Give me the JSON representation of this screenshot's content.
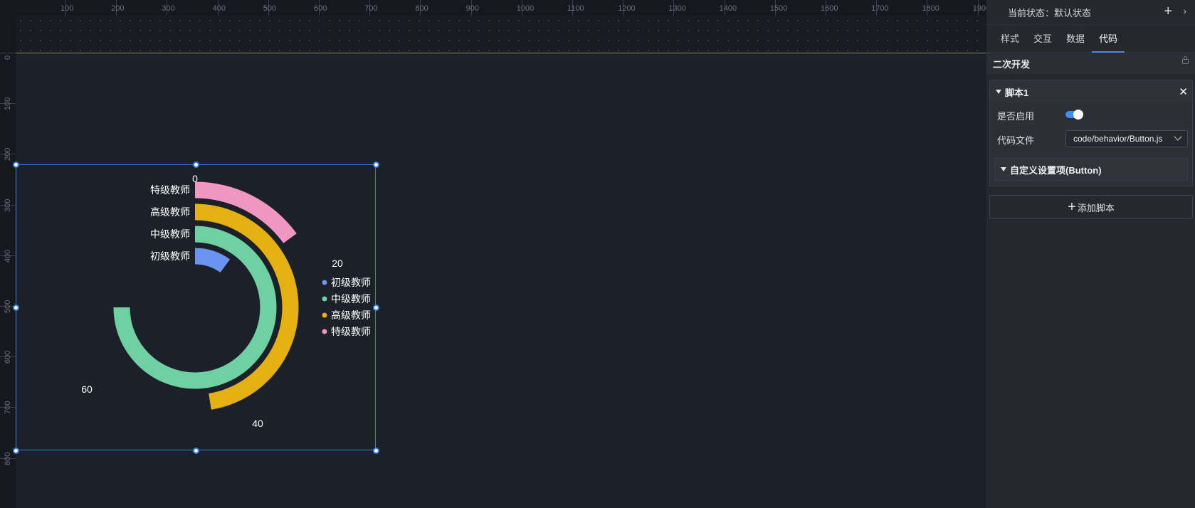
{
  "ruler": {
    "x_ticks": [
      "100",
      "200",
      "300",
      "400",
      "500",
      "600",
      "700",
      "800",
      "900",
      "1000",
      "1100",
      "1200",
      "1300",
      "1400",
      "1500",
      "1600",
      "1700",
      "1800",
      "1900"
    ],
    "y_ticks": [
      "0",
      "100",
      "200",
      "300",
      "400",
      "500",
      "600",
      "700",
      "800"
    ]
  },
  "chart_data": {
    "type": "radial-bar",
    "angle_axis": {
      "min": 0,
      "max": 80,
      "tick_labels": [
        "0",
        "20",
        "40",
        "60"
      ]
    },
    "categories": [
      "初级教师",
      "中级教师",
      "高级教师",
      "特级教师"
    ],
    "values": [
      8,
      60,
      38,
      12
    ],
    "colors": [
      "#6b93f0",
      "#6fd1a2",
      "#e5b012",
      "#ef97c0"
    ],
    "legend": {
      "placement": "right",
      "items": [
        "初级教师",
        "中级教师",
        "高级教师",
        "特级教师"
      ]
    }
  },
  "panel": {
    "state_label": "当前状态：默认状态",
    "tabs": [
      "样式",
      "交互",
      "数据",
      "代码"
    ],
    "active_tab": "代码",
    "section_title": "二次开发",
    "script": {
      "title": "脚本1",
      "enabled_label": "是否启用",
      "enabled": true,
      "file_label": "代码文件",
      "file_value": "code/behavior/Button.js",
      "custom_settings": "自定义设置项(Button)"
    },
    "add_script": "添加脚本"
  }
}
